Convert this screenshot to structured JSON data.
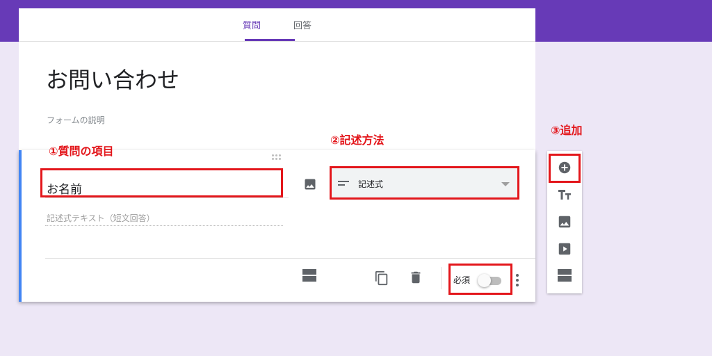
{
  "tabs": [
    {
      "label": "質問",
      "active": true
    },
    {
      "label": "回答",
      "active": false
    }
  ],
  "form": {
    "title": "お問い合わせ",
    "description_placeholder": "フォームの説明"
  },
  "question": {
    "title": "お名前",
    "answer_placeholder": "記述式テキスト（短文回答）",
    "type": "記述式",
    "required_label": "必須",
    "required": false
  },
  "annotations": {
    "item": "①質問の項目",
    "method": "②記述方法",
    "add": "③追加"
  },
  "icons": {
    "image": "image-icon",
    "short_answer": "short-text-icon",
    "dropdown": "arrow-drop-down-icon",
    "section": "section-icon",
    "copy": "copy-icon",
    "delete": "delete-icon",
    "more": "more-vert-icon",
    "add": "add-circle-icon",
    "title": "title-text-icon",
    "video": "video-icon"
  },
  "colors": {
    "brand": "#673ab7",
    "background": "#ede7f6",
    "accent": "#4285f4",
    "annotation": "#e3161b"
  }
}
